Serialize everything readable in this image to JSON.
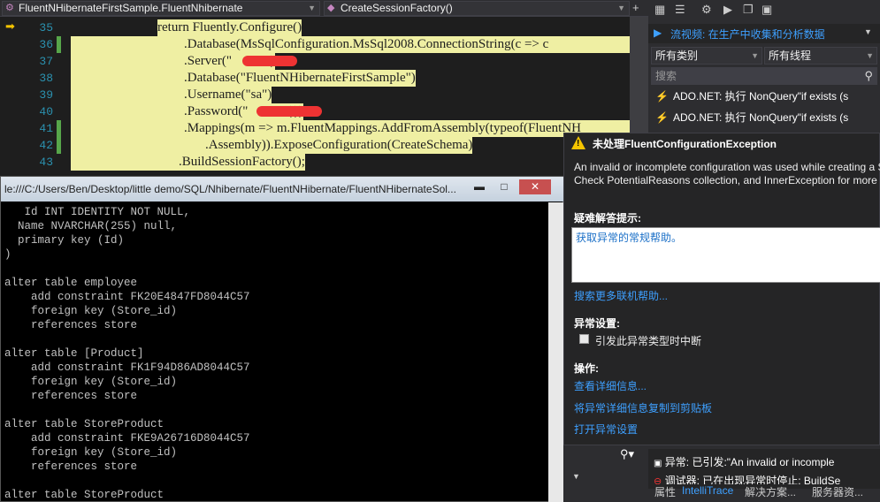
{
  "nav": {
    "class_combo": "FluentNHibernateFirstSample.FluentNhibernate",
    "method_combo": "CreateSessionFactory()"
  },
  "editor": {
    "lines": [
      {
        "num": "35",
        "text": "return Fluently.Configure()"
      },
      {
        "num": "36",
        "text": ".Database(MsSqlConfiguration.MsSql2008.ConnectionString(c => c"
      },
      {
        "num": "37",
        "text": ".Server(\"          \")"
      },
      {
        "num": "38",
        "text": ".Database(\"FluentNHibernateFirstSample\")"
      },
      {
        "num": "39",
        "text": ".Username(\"sa\")"
      },
      {
        "num": "40",
        "text": ".Password(\"           \")))"
      },
      {
        "num": "41",
        "text": ".Mappings(m => m.FluentMappings.AddFromAssembly(typeof(FluentNH"
      },
      {
        "num": "42",
        "text": ".Assembly)).ExposeConfiguration(CreateSchema)"
      },
      {
        "num": "43",
        "text": ".BuildSessionFactory();"
      }
    ]
  },
  "console": {
    "title": "le:///C:/Users/Ben/Desktop/little demo/SQL/Nhibernate/FluentNHibernate/FluentNHibernateSol...",
    "min": "▬",
    "max": "□",
    "close": "✕",
    "text": "   Id INT IDENTITY NOT NULL,\n  Name NVARCHAR(255) null,\n  primary key (Id)\n)\n\nalter table employee\n    add constraint FK20E4847FD8044C57\n    foreign key (Store_id)\n    references store\n\nalter table [Product]\n    add constraint FK1F94D86AD8044C57\n    foreign key (Store_id)\n    references store\n\nalter table StoreProduct\n    add constraint FKE9A26716D8044C57\n    foreign key (Store_id)\n    references store\n\nalter table StoreProduct"
  },
  "intellitrace": {
    "stream": "流视频: 在生产中收集和分析数据",
    "category": "所有类别",
    "thread": "所有线程",
    "search_placeholder": "搜索",
    "events": [
      "ADO.NET: 执行 NonQuery\"if exists (s",
      "ADO.NET: 执行 NonQuery\"if exists (s"
    ]
  },
  "exception": {
    "title": "未处理FluentConfigurationException",
    "message1": "An invalid or incomplete configuration was used while creating a S",
    "message2": "Check PotentialReasons collection, and InnerException for more de",
    "tips_header": "疑难解答提示:",
    "tip": "获取异常的常规帮助。",
    "search_online": "搜索更多联机帮助...",
    "settings_header": "异常设置:",
    "break_label": "引发此异常类型时中断",
    "actions_header": "操作:",
    "view_details": "查看详细信息...",
    "copy": "将异常详细信息复制到剪贴板",
    "open_settings": "打开异常设置"
  },
  "errors": [
    "异常: 已引发:\"An invalid or incomple",
    "调试器: 已在出现异常时停止: BuildSe"
  ],
  "tabs": [
    "属性",
    "IntelliTrace",
    "解决方案...",
    "服务器资..."
  ]
}
